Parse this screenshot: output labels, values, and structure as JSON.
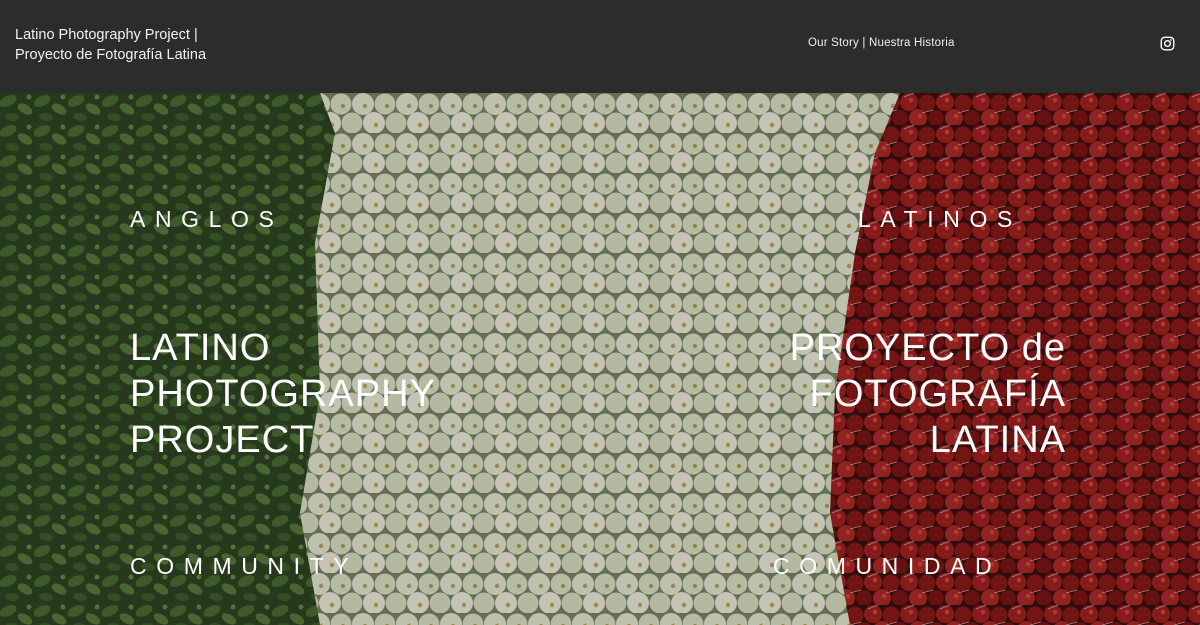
{
  "header": {
    "site_title_line1": "Latino Photography Project |",
    "site_title_line2": "Proyecto de Fotografía Latina",
    "nav_our_story": "Our Story | Nuestra Historia",
    "social_icon": "instagram-icon"
  },
  "hero": {
    "left_top": "ANGLOS",
    "right_top": "LATINOS",
    "left_title": [
      "LATINO",
      "PHOTOGRAPHY",
      "PROJECT"
    ],
    "right_title": [
      "PROYECTO de",
      "FOTOGRAFÍA",
      "LATINA"
    ],
    "left_bottom": "COMMUNITY",
    "right_bottom": "COMUNIDAD",
    "colors": {
      "green": "#3d5a2c",
      "white": "#e9ecd6",
      "red": "#8e1a1a"
    }
  }
}
